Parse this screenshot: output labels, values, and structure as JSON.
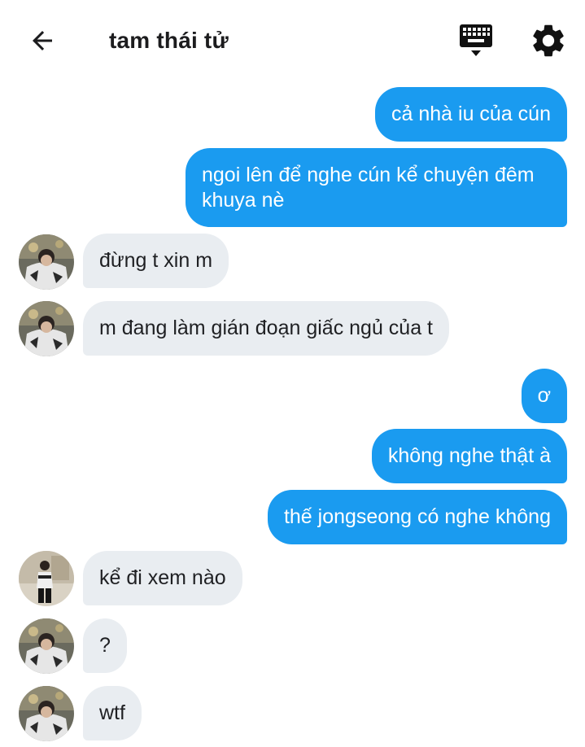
{
  "header": {
    "title": "tam thái tử"
  },
  "icons": {
    "back": "arrow-left-icon",
    "keyboard": "keyboard-icon",
    "settings": "gear-icon"
  },
  "colors": {
    "outgoing_bubble": "#1a9bf0",
    "incoming_bubble": "#e9edf1",
    "text_dark": "#1f2023"
  },
  "messages": [
    {
      "direction": "outgoing",
      "text": "cả nhà iu của cún"
    },
    {
      "direction": "outgoing",
      "text": "ngoi lên để nghe cún kể chuyện đêm khuya nè"
    },
    {
      "direction": "incoming",
      "text": "đừng t xin m"
    },
    {
      "direction": "incoming",
      "text": "m đang làm gián đoạn giấc ngủ của t"
    },
    {
      "direction": "outgoing",
      "text": "ơ"
    },
    {
      "direction": "outgoing",
      "text": "không nghe thật à"
    },
    {
      "direction": "outgoing",
      "text": "thế jongseong có nghe không"
    },
    {
      "direction": "incoming",
      "text": "kể đi xem nào"
    },
    {
      "direction": "incoming",
      "text": "?"
    },
    {
      "direction": "incoming",
      "text": "wtf"
    }
  ]
}
